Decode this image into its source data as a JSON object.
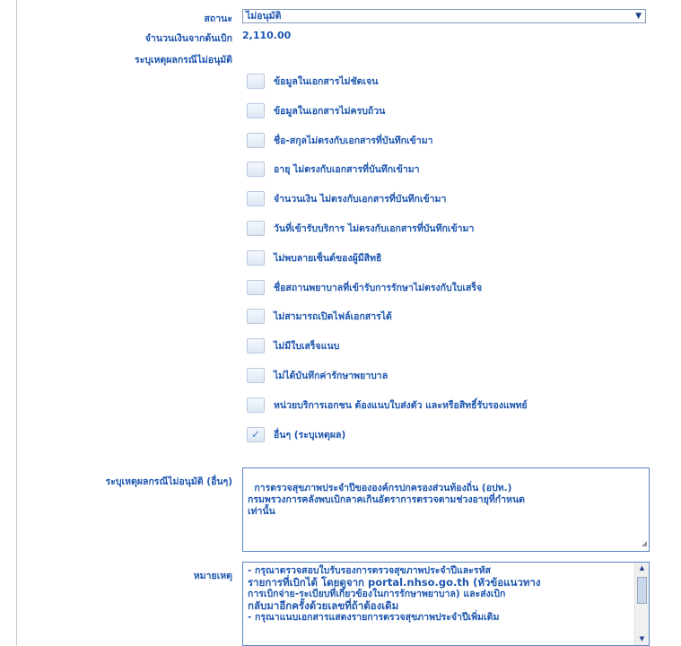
{
  "status": {
    "label": "สถานะ",
    "value": "ไม่อนุมัติ"
  },
  "amount": {
    "label": "จำนวนเงินจากต้นเบิก",
    "value": "2,110.00"
  },
  "reason": {
    "label": "ระบุเหตุผลกรณีไม่อนุมัติ",
    "options": [
      {
        "text": "ข้อมูลในเอกสารไม่ชัดเจน",
        "checked": false
      },
      {
        "text": "ข้อมูลในเอกสารไม่ครบถ้วน",
        "checked": false
      },
      {
        "text": "ชื่อ-สกุลไม่ตรงกับเอกสารที่บันทึกเข้ามา",
        "checked": false
      },
      {
        "text": "อายุ ไม่ตรงกับเอกสารที่บันทึกเข้ามา",
        "checked": false
      },
      {
        "text": "จำนวนเงิน ไม่ตรงกับเอกสารที่บันทึกเข้ามา",
        "checked": false
      },
      {
        "text": "วันที่เข้ารับบริการ ไม่ตรงกับเอกสารที่บันทึกเข้ามา",
        "checked": false
      },
      {
        "text": "ไม่พบลายเซ็นต์ของผู้มีสิทธิ",
        "checked": false
      },
      {
        "text": "ชื่อสถานพยาบาลที่เข้ารับการรักษาไม่ตรงกับใบเสร็จ",
        "checked": false
      },
      {
        "text": "ไม่สามารถเปิดไฟล์เอกสารได้",
        "checked": false
      },
      {
        "text": "ไม่มีใบเสร็จแนบ",
        "checked": false
      },
      {
        "text": "ไม่ได้บันทึกค่ารักษาพยาบาล",
        "checked": false
      },
      {
        "text": "หน่วยบริการเอกชน ต้องแนบใบส่งตัว และหรือสิทธิ์รับรองแพทย์",
        "checked": false
      },
      {
        "text": "อื่นๆ (ระบุเหตุผล)",
        "checked": true
      }
    ]
  },
  "other_reason": {
    "label": "ระบุเหตุผลกรณีไม่อนุมัติ (อื่นๆ)",
    "value": "การตรวจสุขภาพประจำปีขององค์กรปกครองส่วนท้องถิ่น (อปท.)\nกรมพรวงการคลังพบเบิกลาคเกินอัตราการตรวจตามช่วงอายุที่กำหนด\nเท่านั้น"
  },
  "remark": {
    "label": "หมายเหตุ",
    "lines": [
      "- กรุณาตรวจสอบใบรับรองการตรวจสุขภาพประจำปีและรหัส",
      "รายการที่เบิกได้ โดยดูจาก portal.nhso.go.th (หัวข้อแนวทาง",
      "การเบิกจ่าย-ระเบียบที่เกี่ยวข้องในการรักษาพยาบาล) และส่งเบิก",
      "กลับมาอีกครั้งด้วยเลขที่ถ้าต้องเดิม",
      "- กรุณาแนบเอกสารแสดงรายการตรวจสุขภาพประจำปีเพิ่มเติม"
    ]
  },
  "icons": {
    "dropdown": "chevron-down-icon",
    "check": "check-icon"
  }
}
